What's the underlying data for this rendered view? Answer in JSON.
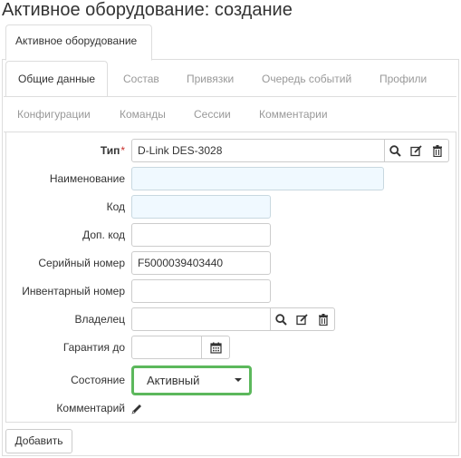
{
  "page": {
    "title": "Активное оборудование: создание"
  },
  "top_tab": {
    "label": "Активное оборудование"
  },
  "tabs_row1": [
    "Общие данные",
    "Состав",
    "Привязки",
    "Очередь событий",
    "Профили"
  ],
  "tabs_row2": [
    "Конфигурации",
    "Команды",
    "Сессии",
    "Комментарии"
  ],
  "form": {
    "type": {
      "label": "Тип",
      "required_mark": "*",
      "value": "D-Link DES-3028"
    },
    "name": {
      "label": "Наименование",
      "value": ""
    },
    "code": {
      "label": "Код",
      "value": ""
    },
    "extra_code": {
      "label": "Доп. код",
      "value": ""
    },
    "serial": {
      "label": "Серийный номер",
      "value": "F5000039403440"
    },
    "inventory": {
      "label": "Инвентарный номер",
      "value": ""
    },
    "owner": {
      "label": "Владелец",
      "value": ""
    },
    "warranty": {
      "label": "Гарантия до",
      "value": ""
    },
    "state": {
      "label": "Состояние",
      "value": "Активный"
    },
    "comment": {
      "label": "Комментарий"
    }
  },
  "actions": {
    "add_label": "Добавить"
  },
  "colors": {
    "accent_green": "#5cb85c",
    "required_bg": "#f0f9ff",
    "required_mark": "#c9302c"
  },
  "icons": [
    "search-icon",
    "edit-icon",
    "trash-icon",
    "calendar-icon",
    "pencil-icon",
    "chevron-down-icon"
  ]
}
